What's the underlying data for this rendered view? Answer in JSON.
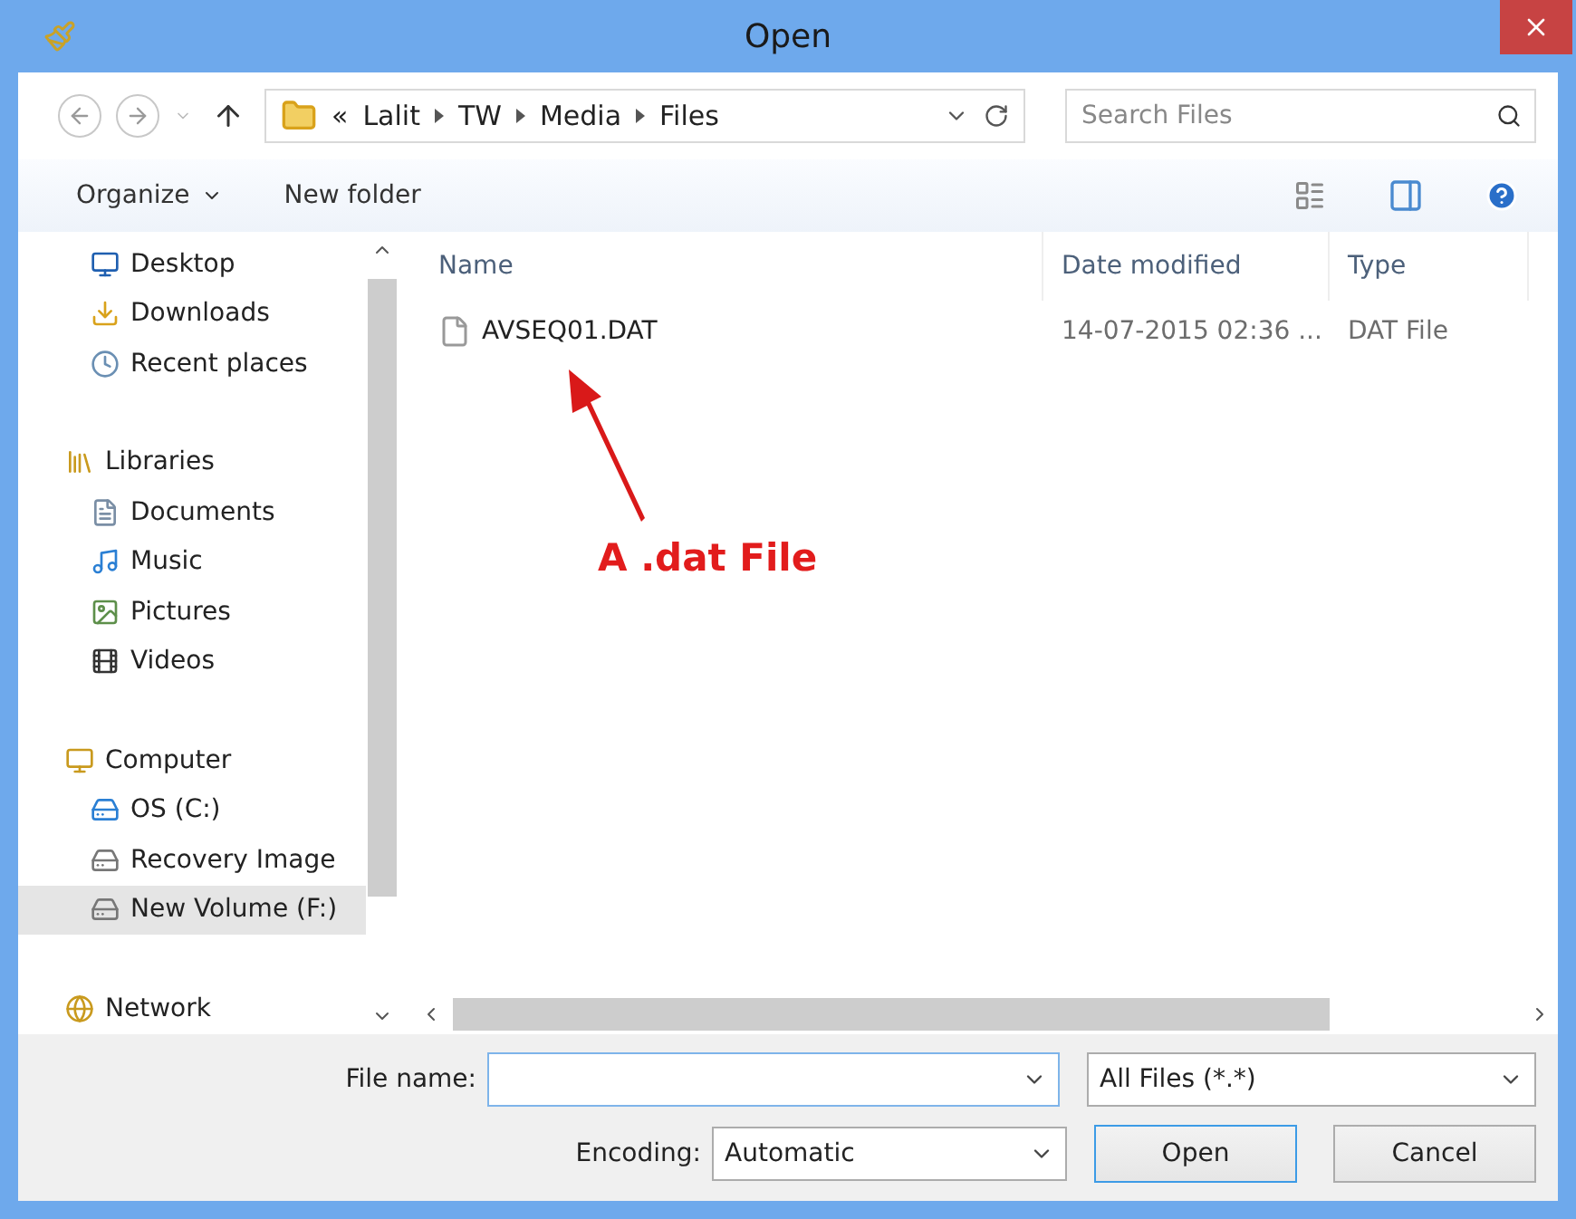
{
  "window": {
    "title": "Open"
  },
  "address_bar": {
    "overflow": "«",
    "breadcrumb": [
      "Lalit",
      "TW",
      "Media",
      "Files"
    ]
  },
  "search": {
    "placeholder": "Search Files"
  },
  "toolbar": {
    "organize": "Organize",
    "new_folder": "New folder"
  },
  "sidebar": {
    "tree": [
      {
        "children": [
          {
            "label": "Desktop",
            "selected": false
          },
          {
            "label": "Downloads",
            "selected": false
          },
          {
            "label": "Recent places",
            "selected": false
          }
        ]
      },
      {
        "label": "Libraries",
        "selected": false,
        "children": [
          {
            "label": "Documents",
            "selected": false
          },
          {
            "label": "Music",
            "selected": false
          },
          {
            "label": "Pictures",
            "selected": false
          },
          {
            "label": "Videos",
            "selected": false
          }
        ]
      },
      {
        "label": "Computer",
        "selected": false,
        "children": [
          {
            "label": "OS (C:)",
            "selected": false
          },
          {
            "label": "Recovery Image",
            "selected": false
          },
          {
            "label": "New Volume (F:)",
            "selected": true
          }
        ]
      },
      {
        "label": "Network",
        "selected": false
      }
    ]
  },
  "table": {
    "columns": [
      "Name",
      "Date modified",
      "Type"
    ],
    "rows": [
      {
        "name": "AVSEQ01.DAT",
        "date": "14-07-2015 02:36 ...",
        "type": "DAT File"
      }
    ]
  },
  "annotation": {
    "text": "A .dat File"
  },
  "bottom": {
    "file_name_label": "File name:",
    "filter": "All Files (*.*)",
    "encoding_label": "Encoding:",
    "encoding": "Automatic",
    "buttons": [
      {
        "label": "Open",
        "default": true
      },
      {
        "label": "Cancel",
        "default": false
      }
    ]
  }
}
